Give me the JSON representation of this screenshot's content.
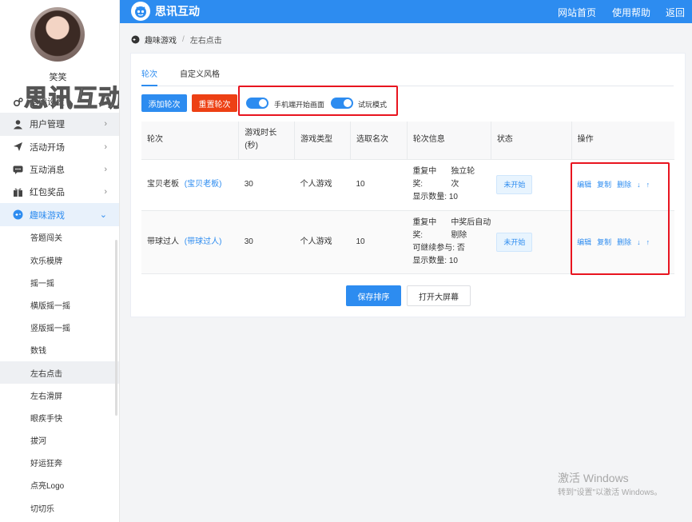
{
  "header": {
    "brand": "思讯互动",
    "nav": [
      "网站首页",
      "使用帮助",
      "返回"
    ]
  },
  "sidebar": {
    "username": "笑笑",
    "watermark": "思讯互动",
    "items": [
      {
        "label": "基础设置",
        "icon": "gears-icon"
      },
      {
        "label": "用户管理",
        "icon": "user-icon"
      },
      {
        "label": "活动开场",
        "icon": "paper-plane-icon"
      },
      {
        "label": "互动消息",
        "icon": "chat-bubble-icon"
      },
      {
        "label": "红包奖品",
        "icon": "gift-icon"
      },
      {
        "label": "趣味游戏",
        "icon": "game-icon"
      }
    ],
    "subitems": [
      "答题闯关",
      "欢乐模牌",
      "摇一摇",
      "横版摇一摇",
      "竖版摇一摇",
      "数钱",
      "左右点击",
      "左右滑屏",
      "眼疾手快",
      "拔河",
      "好运狂奔",
      "点亮Logo",
      "切切乐"
    ]
  },
  "breadcrumb": {
    "parent": "趣味游戏",
    "separator": "/",
    "current": "左右点击"
  },
  "tabs": [
    "轮次",
    "自定义风格"
  ],
  "toolbar": {
    "add": "添加轮次",
    "reset": "重置轮次",
    "switch1": "手机端开始画面",
    "switch2": "试玩模式"
  },
  "table": {
    "headers": [
      "轮次",
      "游戏时长(秒)",
      "游戏类型",
      "选取名次",
      "轮次信息",
      "状态",
      "操作"
    ],
    "header_duration_line1": "游戏时长",
    "header_duration_line2": "(秒)",
    "rows": [
      {
        "name": "宝贝老板",
        "link": "(宝贝老板)",
        "duration": "30",
        "type": "个人游戏",
        "rank": "10",
        "info": {
          "a1": "重复中",
          "a2": "独立轮",
          "b1": "奖:",
          "b2": "次",
          "c": "显示数量: 10"
        },
        "status": "未开始"
      },
      {
        "name": "带球过人",
        "link": "(带球过人)",
        "duration": "30",
        "type": "个人游戏",
        "rank": "10",
        "info": {
          "a1": "重复中",
          "a2": "中奖后自动",
          "b1": "奖:",
          "b2": "剔除",
          "c": "可继续参与: 否",
          "d": "显示数量: 10"
        },
        "status": "未开始"
      }
    ],
    "ops": [
      "编辑",
      "复制",
      "删除",
      "↓",
      "↑"
    ]
  },
  "footer_buttons": {
    "save": "保存排序",
    "open": "打开大屏幕"
  },
  "windows_watermark": {
    "title": "激活 Windows",
    "subtitle": "转到\"设置\"以激活 Windows。"
  },
  "colors": {
    "accent": "#2d8cf0",
    "danger": "#ed4014",
    "highlight_box": "#e8141f"
  }
}
